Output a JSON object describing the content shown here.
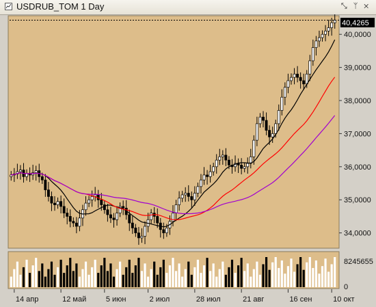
{
  "window": {
    "title": "USDRUB_TOM 1 Day",
    "controls": [
      "⤡",
      "ᛘ",
      "✕"
    ]
  },
  "colors": {
    "panel_bg": "#ddbd8a",
    "frame_bg": "#d4d0c8",
    "candle_up": "#ffffff",
    "candle_down": "#000000",
    "ma_fast": "#000000",
    "ma_mid": "#ff0000",
    "ma_slow": "#a000d0",
    "last_price_line": "#000000"
  },
  "chart_data": {
    "type": "candlestick",
    "instrument": "USDRUB_TOM",
    "timeframe": "1 Day",
    "last_price": "40,4265",
    "last_value": 40.4265,
    "y_ticks": [
      "40,0000",
      "39,0000",
      "38,0000",
      "37,0000",
      "36,0000",
      "35,0000",
      "34,0000"
    ],
    "y_range": [
      33.6,
      40.5
    ],
    "x_ticks": [
      "14 апр",
      "12 май",
      "5 июн",
      "2 июл",
      "28 июл",
      "21 авг",
      "16 сен",
      "10 окт"
    ],
    "volume_label": "8245655",
    "volume_zero_label": "0",
    "close": [
      35.75,
      35.78,
      35.85,
      35.9,
      35.7,
      35.8,
      35.75,
      35.82,
      35.88,
      35.7,
      35.6,
      35.3,
      35.1,
      34.9,
      34.85,
      34.95,
      34.8,
      34.6,
      34.5,
      34.35,
      34.3,
      34.2,
      34.45,
      34.7,
      34.9,
      35.0,
      35.1,
      35.15,
      35.0,
      34.85,
      34.7,
      34.55,
      34.45,
      34.4,
      34.6,
      34.8,
      34.75,
      34.55,
      34.3,
      34.15,
      34.0,
      33.85,
      33.9,
      34.2,
      34.4,
      34.6,
      34.5,
      34.3,
      34.1,
      34.0,
      34.15,
      34.35,
      34.6,
      34.85,
      35.05,
      35.15,
      35.2,
      35.1,
      35.0,
      35.2,
      35.4,
      35.6,
      35.75,
      35.7,
      35.85,
      36.0,
      36.2,
      36.3,
      36.35,
      36.2,
      36.05,
      36.0,
      36.1,
      36.05,
      35.95,
      36.0,
      36.1,
      36.3,
      36.8,
      37.3,
      37.5,
      37.4,
      37.1,
      36.9,
      37.0,
      37.3,
      37.7,
      38.1,
      38.4,
      38.6,
      38.7,
      38.8,
      38.7,
      38.6,
      38.5,
      38.8,
      39.2,
      39.6,
      39.8,
      39.9,
      40.0,
      40.1,
      40.2,
      40.35,
      40.4265
    ]
  }
}
